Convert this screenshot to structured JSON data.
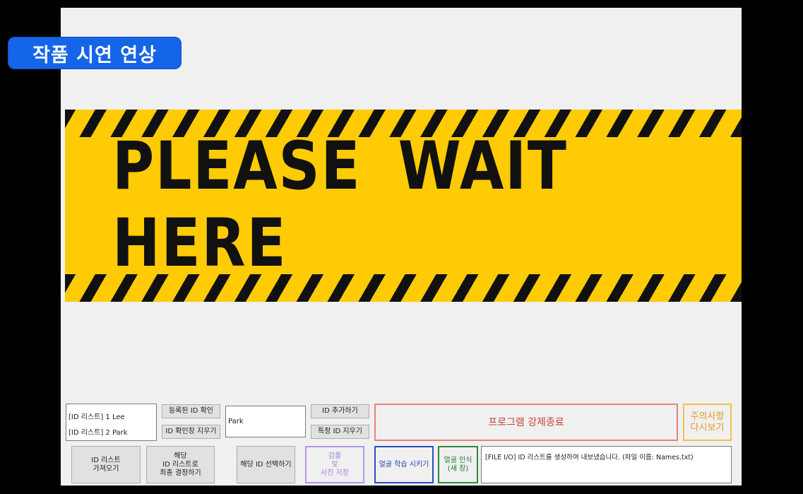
{
  "overlay_badge": "작품 시연 연상",
  "banner": {
    "text": "PLEASE WAIT HERE",
    "colors": {
      "yellow": "#ffcb05",
      "black": "#111111"
    }
  },
  "controls": {
    "id_list": [
      "[ID 리스트] 1 Lee",
      "[ID 리스트] 2 Park"
    ],
    "check_registered_button": "등록된 ID 확인",
    "clear_check_button": "ID 확인창 지우기",
    "name_input_value": "Park",
    "add_id_button": "ID 추가하기",
    "delete_id_button": "특정 ID 지우기",
    "force_exit_button": "프로그램 강제종료",
    "warning_button": "주의사항\n다시보기",
    "fetch_list_button": "ID 리스트\n가져오기",
    "finalize_button": "해당\nID 리스트로\n최종 결정하기",
    "select_id_button": "해당 ID 선택하기",
    "detect_save_button": "검출\n및\n사진 저장",
    "train_button": "얼굴 학습 시키기",
    "recognize_button": "얼굴 인식\n(새 창)",
    "log_text": "[FILE I/O] ID 리스트를 생성하여 내보냈습니다. (파일 이름: Names.txt)"
  }
}
